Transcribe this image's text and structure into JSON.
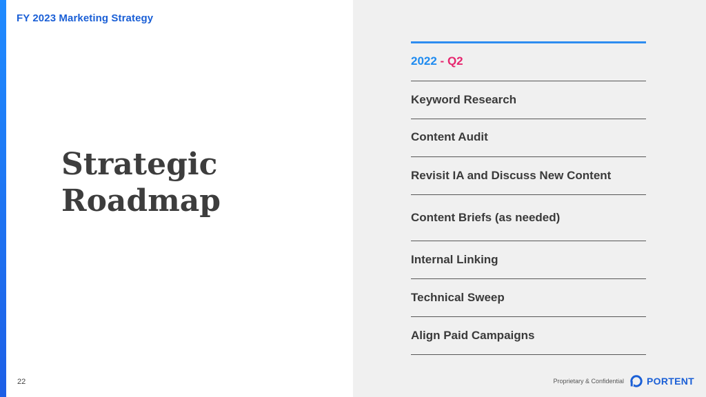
{
  "header": {
    "title": "FY 2023 Marketing Strategy"
  },
  "main": {
    "heading_line1": "Strategic",
    "heading_line2": "Roadmap"
  },
  "page_number": "22",
  "roadmap": {
    "quarter_year": "2022",
    "quarter_sep": " - ",
    "quarter_label": "Q2",
    "items": [
      "Keyword Research",
      "Content Audit",
      "Revisit IA and Discuss New Content",
      "Content Briefs (as needed)",
      "Internal Linking",
      "Technical Sweep",
      "Align Paid Campaigns"
    ]
  },
  "footer": {
    "confidential": "Proprietary & Confidential",
    "logo_text": "PORTENT",
    "logo_icon": "portent-o-icon"
  },
  "colors": {
    "brand_blue": "#1a5fd6",
    "accent_blue": "#1e8bf0",
    "accent_pink": "#e6266e",
    "panel_bg": "#f0f0f0"
  }
}
